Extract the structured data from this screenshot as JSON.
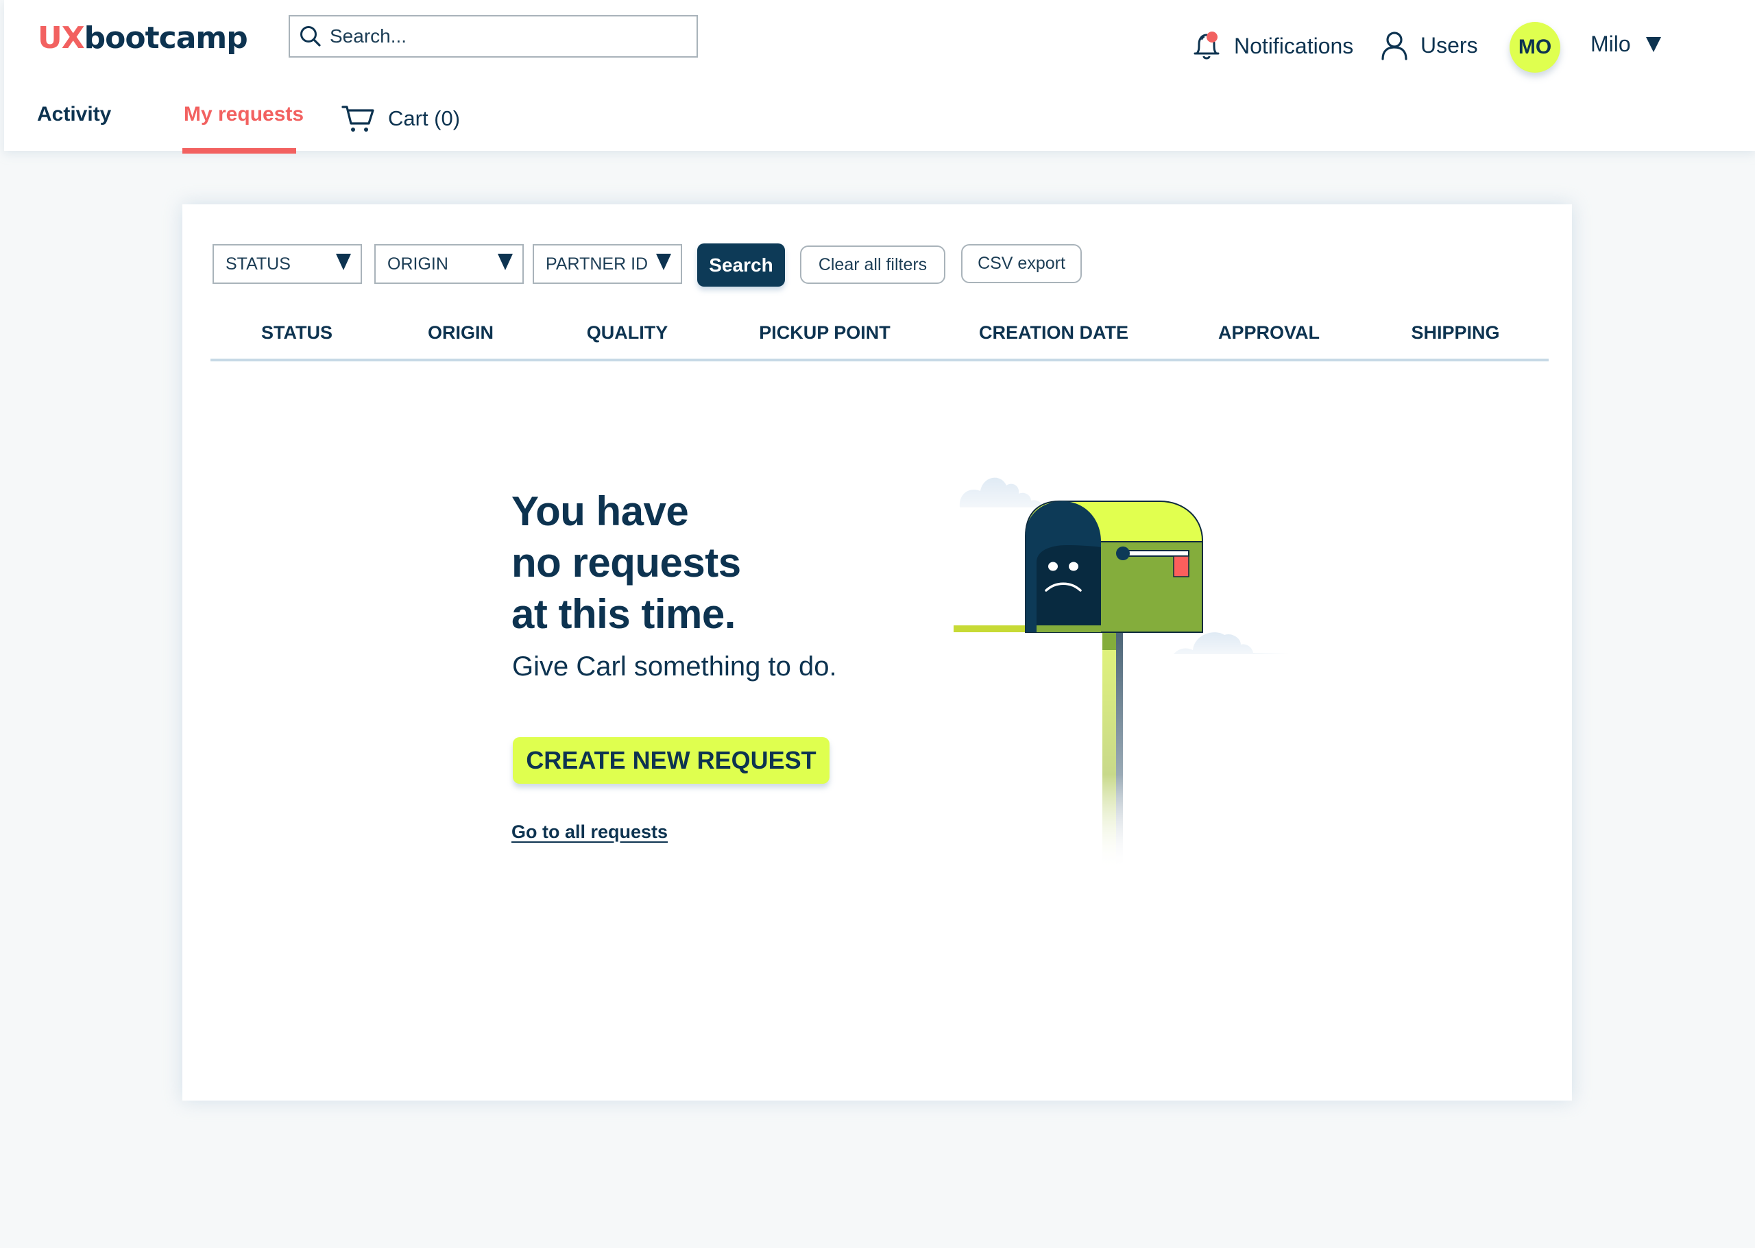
{
  "brand": {
    "logo_prefix": "UX",
    "logo_suffix": "bootcamp",
    "accent_color": "#f26160",
    "primary_color": "#0d3350",
    "highlight_color": "#dfff4f"
  },
  "header": {
    "search": {
      "placeholder": "Search...",
      "value": ""
    },
    "tabs": [
      {
        "label": "Activity",
        "active": false
      },
      {
        "label": "My requests",
        "active": true
      }
    ],
    "cart": {
      "label": "Cart (0)",
      "icon": "cart-icon",
      "count": 0
    },
    "notifications": {
      "label": "Notifications",
      "icon": "bell-icon",
      "has_unread": true
    },
    "users": {
      "label": "Users",
      "icon": "user-icon"
    },
    "account": {
      "initials": "MO",
      "name": "Milo",
      "icon": "caret-down-icon"
    }
  },
  "filters": {
    "selects": [
      {
        "label": "STATUS"
      },
      {
        "label": "ORIGIN"
      },
      {
        "label": "PARTNER ID"
      }
    ],
    "search_label": "Search",
    "clear_label": "Clear all filters",
    "export_label": "CSV export"
  },
  "table": {
    "columns": [
      "STATUS",
      "ORIGIN",
      "QUALITY",
      "PICKUP POINT",
      "CREATION DATE",
      "APPROVAL",
      "SHIPPING"
    ],
    "rows": []
  },
  "empty_state": {
    "headline_lines": [
      "You have",
      "no requests",
      "at this time."
    ],
    "subtitle": "Give Carl something to do.",
    "cta_label": "CREATE NEW REQUEST",
    "link_label": "Go to all requests",
    "illustration": "sad-mailbox-icon"
  }
}
